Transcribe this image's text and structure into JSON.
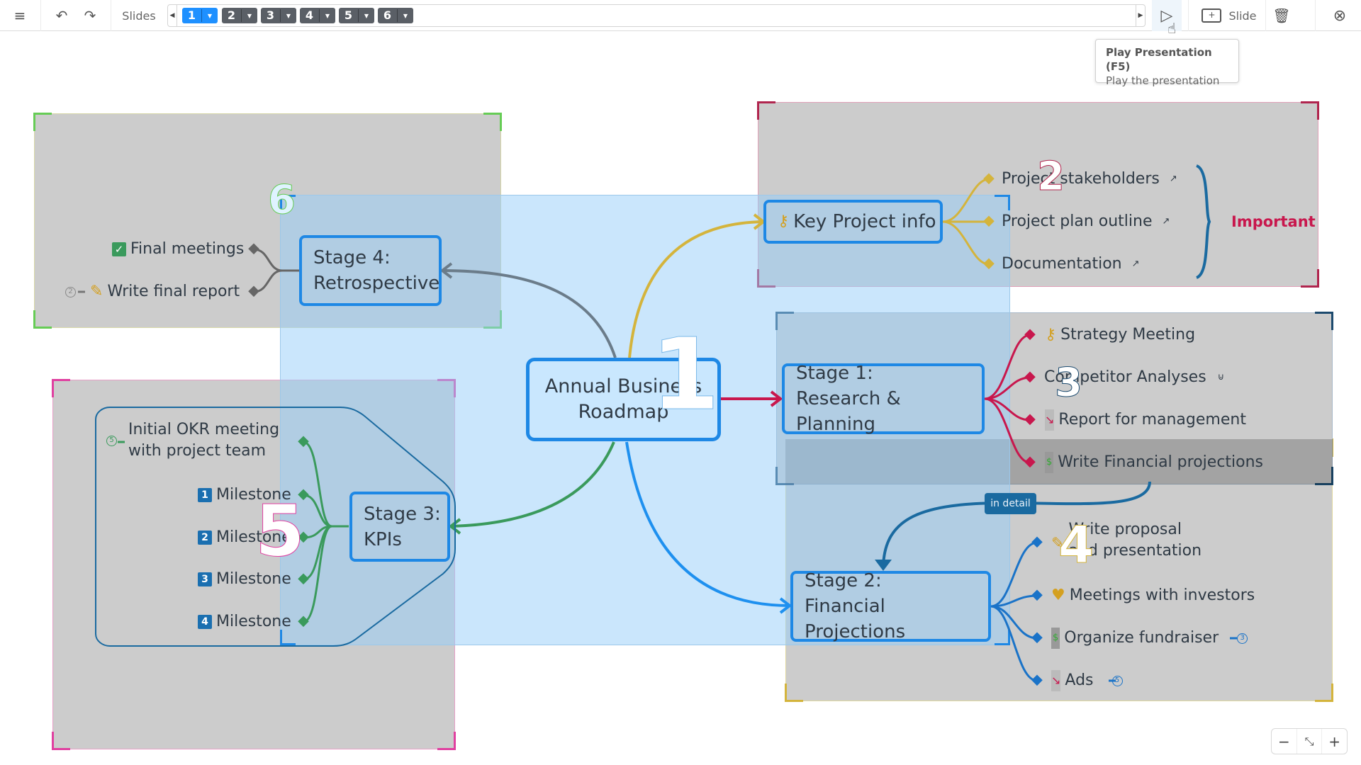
{
  "toolbar": {
    "menu_icon": "hamburger-icon",
    "undo_icon": "undo-icon",
    "redo_icon": "redo-icon",
    "slides_label": "Slides",
    "slides": [
      {
        "number": "1",
        "active": true
      },
      {
        "number": "2",
        "active": false
      },
      {
        "number": "3",
        "active": false
      },
      {
        "number": "4",
        "active": false
      },
      {
        "number": "5",
        "active": false
      },
      {
        "number": "6",
        "active": false
      }
    ],
    "play_icon": "play-icon",
    "add_slide_label": "Slide",
    "delete_icon": "trash-icon",
    "close_icon": "close-circle-icon"
  },
  "tooltip": {
    "title": "Play Presentation (F5)",
    "description": "Play the presentation"
  },
  "colors": {
    "accent": "#1e90ff",
    "chip_inactive": "#5a5f66",
    "node_border": "#1e88e5",
    "branch_yellow": "#d4b43c",
    "branch_crimson": "#c8174d",
    "branch_blue": "#1a73c8",
    "branch_green": "#3a9a5c",
    "branch_gray": "#6b7c8a",
    "important": "#c8174d"
  },
  "slide_frames": [
    {
      "number": "1",
      "color": "#7ab8e8"
    },
    {
      "number": "2",
      "color": "#b0254e"
    },
    {
      "number": "3",
      "color": "#1c4a6e"
    },
    {
      "number": "4",
      "color": "#d4b43c"
    },
    {
      "number": "5",
      "color": "#e040a0"
    },
    {
      "number": "6",
      "color": "#66cc55"
    }
  ],
  "mindmap": {
    "center": {
      "line1": "Annual Business",
      "line2": "Roadmap"
    },
    "key_info": {
      "label": "Key Project info",
      "icon": "key-icon",
      "children": [
        {
          "label": "Project stakeholders",
          "icon": "external-link-icon"
        },
        {
          "label": "Project plan outline",
          "icon": "external-link-icon"
        },
        {
          "label": "Documentation",
          "icon": "external-link-icon"
        }
      ],
      "callout": "Important"
    },
    "stage1": {
      "line1": "Stage 1:",
      "line2": "Research & Planning",
      "children": [
        {
          "label": "Strategy Meeting",
          "icon": "key-icon"
        },
        {
          "label": "Competitor Analyses",
          "icon": "paperclip-icon"
        },
        {
          "label": "Report for management",
          "icon": "chart-down-icon"
        },
        {
          "label": "Write Financial projections",
          "icon": "money-icon"
        }
      ]
    },
    "relation_label": "in detail",
    "stage2": {
      "line1": "Stage 2:",
      "line2": "Financial Projections",
      "children": [
        {
          "line1": "Write proposal",
          "line2": "and presentation",
          "icon": "pencil-icon"
        },
        {
          "label": "Meetings with investors",
          "icon": "handshake-icon"
        },
        {
          "label": "Organize fundraiser",
          "icon": "money-icon",
          "count": "3"
        },
        {
          "label": "Ads",
          "icon": "chart-down-icon",
          "count": "5"
        }
      ]
    },
    "stage3": {
      "line1": "Stage 3:",
      "line2": "KPIs",
      "children": [
        {
          "line1": "Initial OKR meeting",
          "line2": "with project team",
          "count": "5"
        },
        {
          "label": "Milestone",
          "badge": "1"
        },
        {
          "label": "Milestone",
          "badge": "2"
        },
        {
          "label": "Milestone",
          "badge": "3"
        },
        {
          "label": "Milestone",
          "badge": "4"
        }
      ]
    },
    "stage4": {
      "line1": "Stage 4:",
      "line2": "Retrospective",
      "children": [
        {
          "label": "Final meetings",
          "icon": "checkmark-icon"
        },
        {
          "label": "Write final report",
          "icon": "pencil-icon",
          "count": "2"
        }
      ]
    }
  },
  "zoom_controls": {
    "zoom_out": "−",
    "zoom_in": "+",
    "fit_icon": "collapse-icon"
  }
}
